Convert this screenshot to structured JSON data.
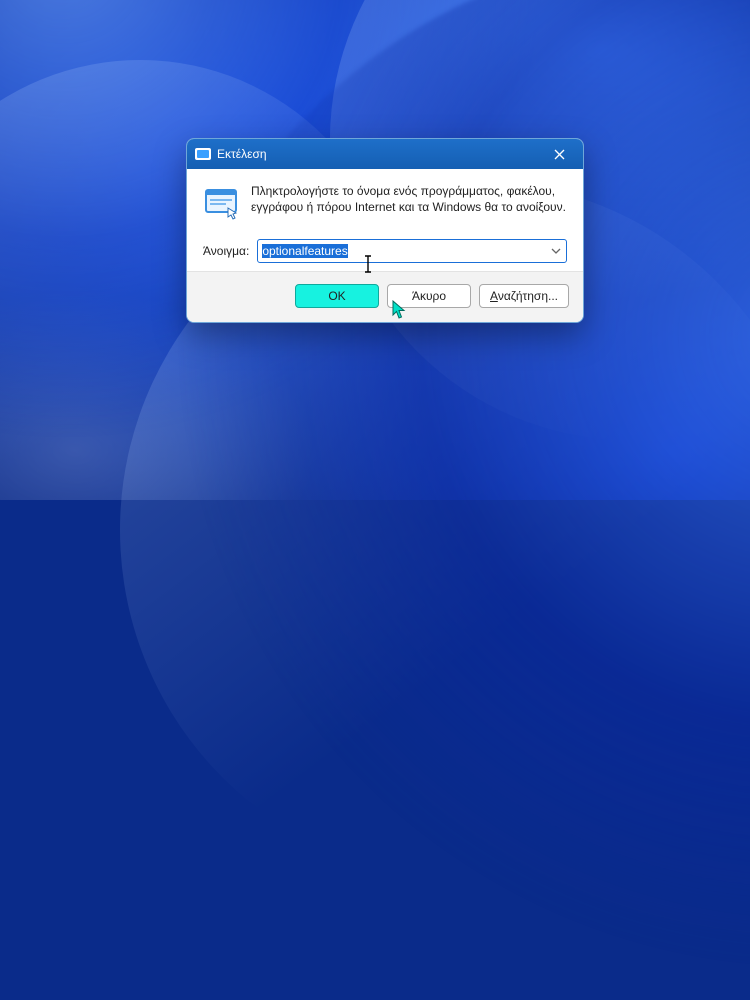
{
  "dialog": {
    "title": "Εκτέλεση",
    "instruction": "Πληκτρολογήστε το όνομα ενός προγράμματος, φακέλου, εγγράφου ή πόρου Internet και τα Windows θα το ανοίξουν.",
    "open_label": "Άνοιγμα:",
    "input_value": "optionalfeatures",
    "buttons": {
      "ok": "OK",
      "cancel": "Άκυρο",
      "browse": "Αναζήτηση..."
    }
  }
}
